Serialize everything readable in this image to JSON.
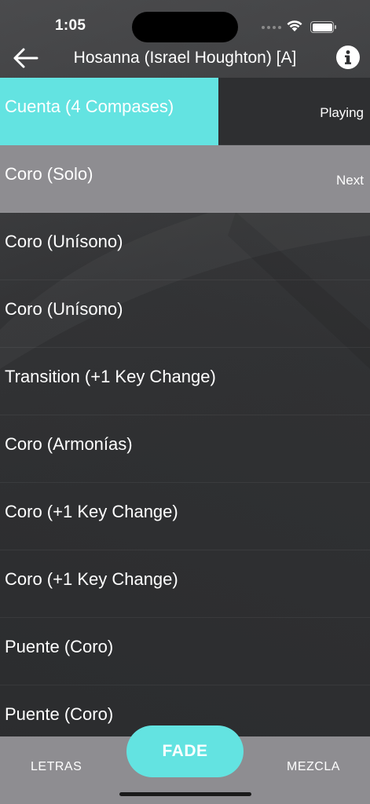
{
  "status_bar": {
    "time": "1:05"
  },
  "nav": {
    "title": "Hosanna (Israel Houghton) [A]",
    "back_icon": "arrow-left-icon",
    "info_icon": "info-icon"
  },
  "sections": [
    {
      "label": "Cuenta (4 Compases)",
      "status": "Playing",
      "progress": 0.59
    },
    {
      "label": "Coro (Solo)",
      "status": "Next"
    },
    {
      "label": "Coro (Unísono)"
    },
    {
      "label": "Coro (Unísono)"
    },
    {
      "label": "Transition (+1 Key Change)"
    },
    {
      "label": "Coro (Armonías)"
    },
    {
      "label": "Coro (+1 Key Change)"
    },
    {
      "label": "Coro (+1 Key Change)"
    },
    {
      "label": "Puente (Coro)"
    },
    {
      "label": "Puente (Coro)"
    }
  ],
  "tabbar": {
    "left_label": "LETRAS",
    "center_label": "FADE",
    "right_label": "MEZCLA"
  },
  "colors": {
    "accent": "#63e3e1",
    "next_row": "#8e8d91",
    "tabbar": "#8e8d91"
  }
}
